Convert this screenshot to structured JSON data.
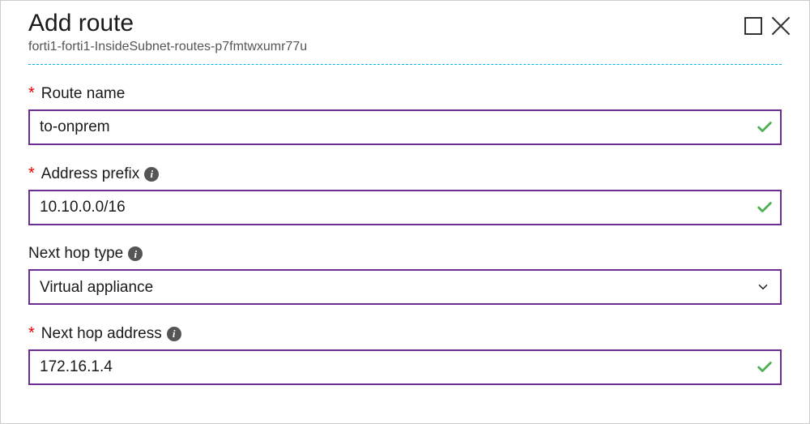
{
  "header": {
    "title": "Add route",
    "subtitle": "forti1-forti1-InsideSubnet-routes-p7fmtwxumr77u"
  },
  "form": {
    "route_name": {
      "label": "Route name",
      "required": true,
      "value": "to-onprem",
      "valid": true,
      "has_info": false
    },
    "address_prefix": {
      "label": "Address prefix",
      "required": true,
      "value": "10.10.0.0/16",
      "valid": true,
      "has_info": true
    },
    "next_hop_type": {
      "label": "Next hop type",
      "required": false,
      "value": "Virtual appliance",
      "has_info": true
    },
    "next_hop_address": {
      "label": "Next hop address",
      "required": true,
      "value": "172.16.1.4",
      "valid": true,
      "has_info": true
    }
  },
  "icons": {
    "info_glyph": "i"
  }
}
